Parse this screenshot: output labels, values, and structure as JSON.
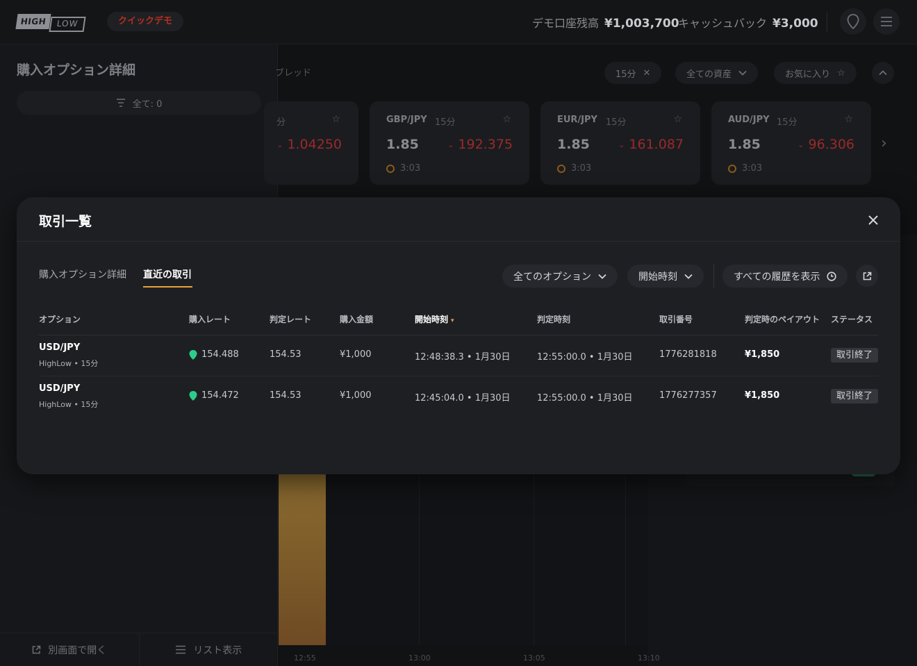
{
  "header": {
    "logo_high": "HIGH",
    "logo_low": "LOW",
    "demo_badge": "クイックデモ",
    "balance_label": "デモ口座残高",
    "balance_value": "¥1,003,700",
    "cashback_label": "キャッシュバック",
    "cashback_value": "¥3,000",
    "pin_icon": "location-pin-icon",
    "menu_icon": "hamburger-menu-icon"
  },
  "left_panel": {
    "title": "購入オプション詳細",
    "filter_label": "全て: 0",
    "footer": {
      "open_separate": "別画面で開く",
      "list_view": "リスト表示"
    }
  },
  "asset_bar": {
    "label": "ブレッド",
    "duration_filter": "15分",
    "all_assets": "全ての資産",
    "favorites": "お気に入り",
    "cards": [
      {
        "rate": "1.04250"
      },
      {
        "pair": "GBP/JPY",
        "duration": "15分",
        "payout": "1.85",
        "rate": "192.375",
        "timer": "3:03"
      },
      {
        "pair": "EUR/JPY",
        "duration": "15分",
        "payout": "1.85",
        "rate": "161.087",
        "timer": "3:03"
      },
      {
        "pair": "AUD/JPY",
        "duration": "15分",
        "payout": "1.85",
        "rate": "96.306",
        "timer": "3:03"
      }
    ]
  },
  "chart": {
    "x_ticks": [
      "12:55",
      "13:00",
      "13:05",
      "13:10"
    ]
  },
  "modal": {
    "title": "取引一覧",
    "tabs": [
      {
        "label": "購入オプション詳細",
        "active": false
      },
      {
        "label": "直近の取引",
        "active": true
      }
    ],
    "filters": {
      "options": "全てのオプション",
      "sort": "開始時刻",
      "history": "すべての履歴を表示"
    },
    "columns": [
      "オプション",
      "購入レート",
      "判定レート",
      "購入金額",
      "開始時刻",
      "判定時刻",
      "取引番号",
      "判定時のペイアウト",
      "ステータス"
    ],
    "rows": [
      {
        "option": "USD/JPY",
        "option_sub": "HighLow • 15分",
        "purchase_rate": "154.488",
        "judge_rate": "154.53",
        "amount": "¥1,000",
        "start_time": "12:48:38.3 • 1月30日",
        "judge_time": "12:55:00.0 • 1月30日",
        "trade_no": "1776281818",
        "payout": "¥1,850",
        "status": "取引終了"
      },
      {
        "option": "USD/JPY",
        "option_sub": "HighLow • 15分",
        "purchase_rate": "154.472",
        "judge_rate": "154.53",
        "amount": "¥1,000",
        "start_time": "12:45:04.0 • 1月30日",
        "judge_time": "12:55:00.0 • 1月30日",
        "trade_no": "1776277357",
        "payout": "¥1,850",
        "status": "取引終了"
      }
    ]
  },
  "colors": {
    "accent": "#e8a33a",
    "down_rate": "#9a2a2a",
    "pin_green": "#2ecc8a",
    "demo_red": "#b3301f"
  }
}
